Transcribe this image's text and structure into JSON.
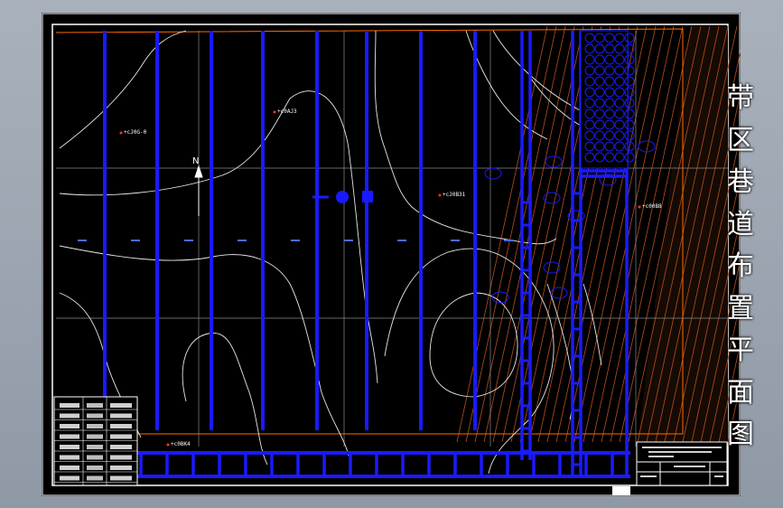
{
  "drawing": {
    "title_chars": [
      "带",
      "区",
      "巷",
      "道",
      "布",
      "置",
      "平",
      "面",
      "图"
    ],
    "north_label": "N",
    "colors": {
      "background": "#000000",
      "border": "#ffffff",
      "roadway": "#1a1aff",
      "contour": "#ffffff",
      "boundary": "#ff6a00",
      "hatch": "#b5501c"
    },
    "block_labels": [
      "+cJ0G-0",
      "+c0AJ3",
      "+c0BK4",
      "+cJ0B31",
      "+c00B8"
    ]
  }
}
